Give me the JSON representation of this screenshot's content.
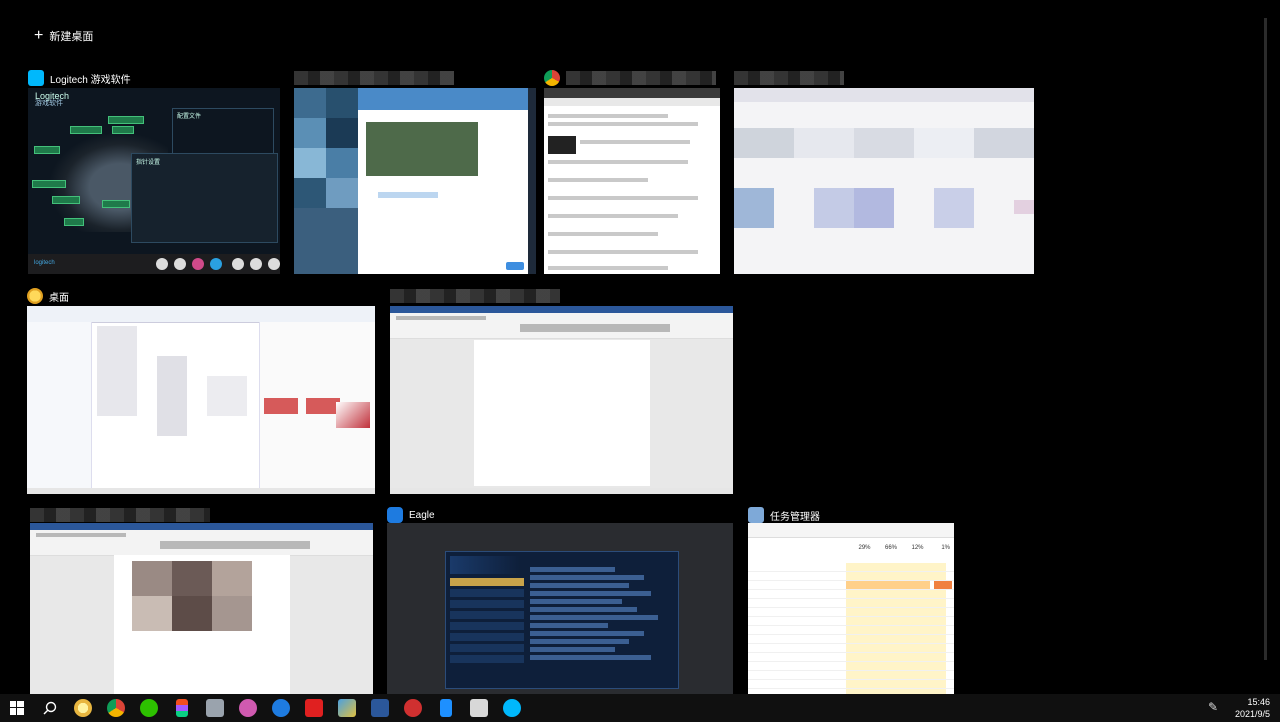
{
  "new_desktop": {
    "icon": "plus-icon",
    "label": "新建桌面"
  },
  "windows": {
    "logitech": {
      "title": "Logitech 游戏软件",
      "icon": "logitech-icon",
      "brand": "Logitech",
      "subtitle": "游戏软件",
      "panel_title": "指针设置",
      "profile_title": "配置文件",
      "bar_logo": "logitech"
    },
    "blurred_dialog": {
      "title": "",
      "icon": "app-icon"
    },
    "chrome": {
      "title": "",
      "icon": "chrome-icon"
    },
    "blurred_doc": {
      "title": "",
      "icon": "app-icon"
    },
    "desktop": {
      "title": "桌面",
      "icon": "desktop-folder-icon"
    },
    "word_1": {
      "title": "",
      "icon": "word-icon"
    },
    "word_2": {
      "title": "",
      "icon": "word-icon"
    },
    "eagle": {
      "title": "Eagle",
      "icon": "eagle-icon"
    },
    "task_manager": {
      "title": "任务管理器",
      "icon": "task-manager-icon",
      "col_cpu": "29%",
      "col_mem": "66%",
      "col_disk": "12%",
      "col_net": "1%"
    }
  },
  "taskbar": {
    "apps": [
      {
        "name": "start-icon"
      },
      {
        "name": "search-icon"
      },
      {
        "name": "paint-icon"
      },
      {
        "name": "chrome-icon"
      },
      {
        "name": "wechat-icon"
      },
      {
        "name": "figma-icon"
      },
      {
        "name": "explorer-icon"
      },
      {
        "name": "music-icon"
      },
      {
        "name": "edge-icon"
      },
      {
        "name": "huawei-icon"
      },
      {
        "name": "game-icon"
      },
      {
        "name": "word-icon"
      },
      {
        "name": "netease-icon"
      },
      {
        "name": "phone-icon"
      },
      {
        "name": "screenshot-icon"
      },
      {
        "name": "logitech-icon"
      }
    ],
    "time": "15:46",
    "date": "2021/9/5"
  },
  "colors": {
    "background": "#000000",
    "taskbar": "#101010",
    "word_blue": "#2b579a",
    "eagle_navy": "#0e1f3a"
  }
}
